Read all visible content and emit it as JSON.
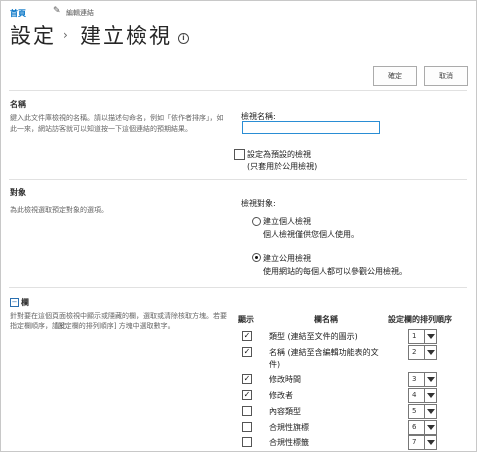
{
  "breadcrumb": {
    "home": "首頁",
    "edit_links": "編輯連結"
  },
  "header": {
    "title_settings": "設定",
    "title_page": "建立檢視",
    "info_icon": "info-icon"
  },
  "toolbar": {
    "ok": "確定",
    "cancel": "取消"
  },
  "name_section": {
    "heading": "名稱",
    "description_line1": "鍵入此文件庫檢視的名稱。請以描述句命名，例如「依作者排序」，如",
    "description_line2": "此一來，網站訪客就可以知道按一下這個連結的預期結果。",
    "field_label": "檢視名稱:",
    "field_value": "",
    "default_check_label": "設定為預設的檢視",
    "default_check_sub": "(只套用於公用檢視)",
    "default_checked": false
  },
  "audience_section": {
    "heading": "對象",
    "description": "為此檢視選取預定對象的選項。",
    "label": "檢視對象:",
    "options": [
      {
        "title": "建立個人檢視",
        "sub": "個人檢視僅供您個人使用。",
        "selected": false
      },
      {
        "title": "建立公用檢視",
        "sub": "使用網站的每個人都可以參觀公用檢視。",
        "selected": true
      }
    ]
  },
  "columns_section": {
    "heading": "欄",
    "collapse_icon": "minus-box-icon",
    "description_line1": "針對要在這個頁面檢視中顯示或隱藏的欄，選取或清除核取方塊。若要指定欄順序，請於",
    "description_line2": "[設定欄的排列順序] 方塊中選取數字。",
    "col_show": "顯示",
    "col_name": "欄名稱",
    "col_order": "設定欄的排列順序",
    "rows": [
      {
        "checked": true,
        "name": "類型 (連結至文件的圖示)",
        "order": "1"
      },
      {
        "checked": true,
        "name": "名稱 (連結至含編輯功能表的文件)",
        "order": "2"
      },
      {
        "checked": true,
        "name": "修改時間",
        "order": "3"
      },
      {
        "checked": true,
        "name": "修改者",
        "order": "4"
      },
      {
        "checked": false,
        "name": "內容類型",
        "order": "5"
      },
      {
        "checked": false,
        "name": "合規性旗標",
        "order": "6"
      },
      {
        "checked": false,
        "name": "合規性標籤",
        "order": "7"
      }
    ]
  },
  "colors": {
    "link": "#0072c6",
    "border": "#c8c8c8",
    "text": "#333333"
  }
}
